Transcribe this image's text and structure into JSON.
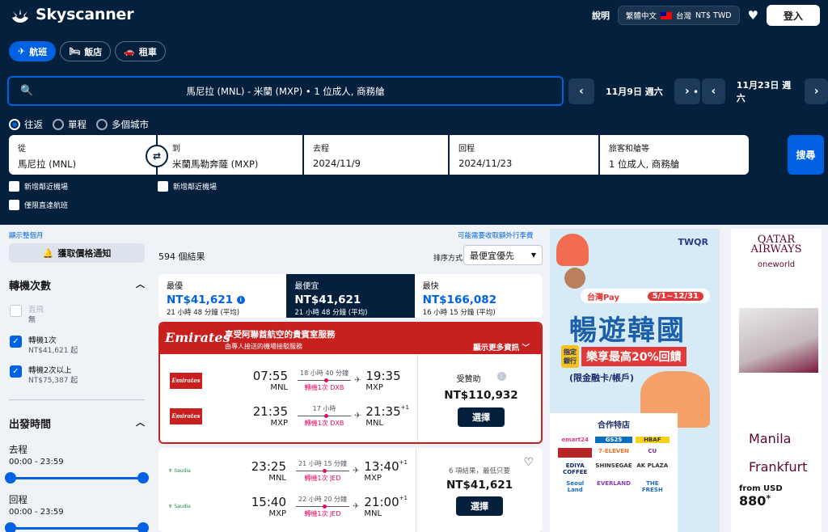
{
  "header": {
    "brand": "Skyscanner",
    "help": "說明",
    "locale": "繁體中文",
    "region": "台灣",
    "currency": "NT$ TWD",
    "login": "登入"
  },
  "modes": [
    {
      "label": "航班",
      "icon": "plane-icon"
    },
    {
      "label": "飯店",
      "icon": "bed-icon"
    },
    {
      "label": "租車",
      "icon": "car-icon"
    }
  ],
  "summary": {
    "text": "馬尼拉 (MNL) - 米蘭 (MXP) • 1 位成人, 商務艙",
    "outbound_date": "11月9日 週六",
    "return_date": "11月23日 週六"
  },
  "trip_types": [
    "往返",
    "單程",
    "多個城市"
  ],
  "fields": {
    "from_label": "從",
    "from_value": "馬尼拉 (MNL)",
    "to_label": "到",
    "to_value": "米蘭馬勒奔薩 (MXP)",
    "depart_label": "去程",
    "depart_value": "2024/11/9",
    "return_label": "回程",
    "return_value": "2024/11/23",
    "pax_label": "旅客和艙等",
    "pax_value": "1 位成人, 商務艙"
  },
  "search_button": "搜尋",
  "nearby_airports": "新增鄰近機場",
  "direct_only": "僅限直達航班",
  "filters": {
    "show_month": "顯示整個月",
    "price_alert": "獲取價格通知",
    "stops_title": "轉機次數",
    "stops": [
      {
        "label": "直飛",
        "price": "無",
        "checked": false,
        "disabled": true
      },
      {
        "label": "轉機1次",
        "price": "NT$41,621 起",
        "checked": true,
        "disabled": false
      },
      {
        "label": "轉機2次以上",
        "price": "NT$75,387 起",
        "checked": true,
        "disabled": false
      }
    ],
    "times_title": "出發時間",
    "outbound_label": "去程",
    "outbound_range": "00:00 - 23:59",
    "return_label": "回程",
    "return_range": "00:00 - 23:59"
  },
  "results": {
    "fees_note": "可能需要收取額外行李費",
    "count": "594 個結果",
    "sort_label": "排序方式",
    "sort_value": "最便宜優先",
    "tabs": [
      {
        "name": "最優",
        "price": "NT$41,621",
        "duration": "21 小時 48 分鐘 (平均)"
      },
      {
        "name": "最便宜",
        "price": "NT$41,621",
        "duration": "21 小時 48 分鐘 (平均)"
      },
      {
        "name": "最快",
        "price": "NT$166,082",
        "duration": "16 小時 15 分鐘 (平均)"
      }
    ]
  },
  "card1": {
    "banner_brand": "Emirates",
    "banner_title": "享受阿聯酋航空的貴賓室服務",
    "banner_sub": "由專人接送的機場接駁服務",
    "banner_more": "顯示更多資訊",
    "airline_logo": "Emirates",
    "legs": [
      {
        "dep": "07:55",
        "dep_code": "MNL",
        "duration": "18 小時 40 分鐘",
        "stops": "轉機1次 DXB",
        "arr": "19:35",
        "arr_code": "MXP",
        "plus": ""
      },
      {
        "dep": "21:35",
        "dep_code": "MXP",
        "duration": "17 小時",
        "stops": "轉機1次 DXB",
        "arr": "21:35",
        "arr_code": "MNL",
        "plus": "+1"
      }
    ],
    "tag": "受贊助",
    "price": "NT$110,932",
    "select": "選擇"
  },
  "card2": {
    "airline_logo": "Saudia",
    "legs": [
      {
        "dep": "23:25",
        "dep_code": "MNL",
        "duration": "21 小時 15 分鐘",
        "stops": "轉機1次 JED",
        "arr": "13:40",
        "arr_code": "MXP",
        "plus": "+1"
      },
      {
        "dep": "15:40",
        "dep_code": "MXP",
        "duration": "22 小時 20 分鐘",
        "stops": "轉機1次 JED",
        "arr": "21:00",
        "arr_code": "MNL",
        "plus": "+1"
      }
    ],
    "deals": "6 項結果，最低只要",
    "price": "NT$41,621",
    "select": "選擇"
  },
  "ad1": {
    "brand": "TWQR",
    "pay": "台灣Pay",
    "dates": "5/1~12/31",
    "headline": "暢遊韓國",
    "tag": "指定銀行",
    "offer": "樂享最高20%回饋",
    "note": "(限金融卡/帳戶)",
    "stores_title": "合作特店",
    "stores": [
      "emart24",
      "GS25",
      "HBAF",
      "",
      "7-ELEVEN",
      "CU",
      "EDIYA COFFEE",
      "SHINSEGAE",
      "AK PLAZA",
      "Seoul Land",
      "EVERLAND",
      "THE FRESH"
    ]
  },
  "ad2": {
    "brand": "QATAR AIRWAYS",
    "alliance": "oneworld",
    "city1": "Manila",
    "city2": "Frankfurt",
    "from": "from USD",
    "price": "880",
    "star": "*"
  }
}
